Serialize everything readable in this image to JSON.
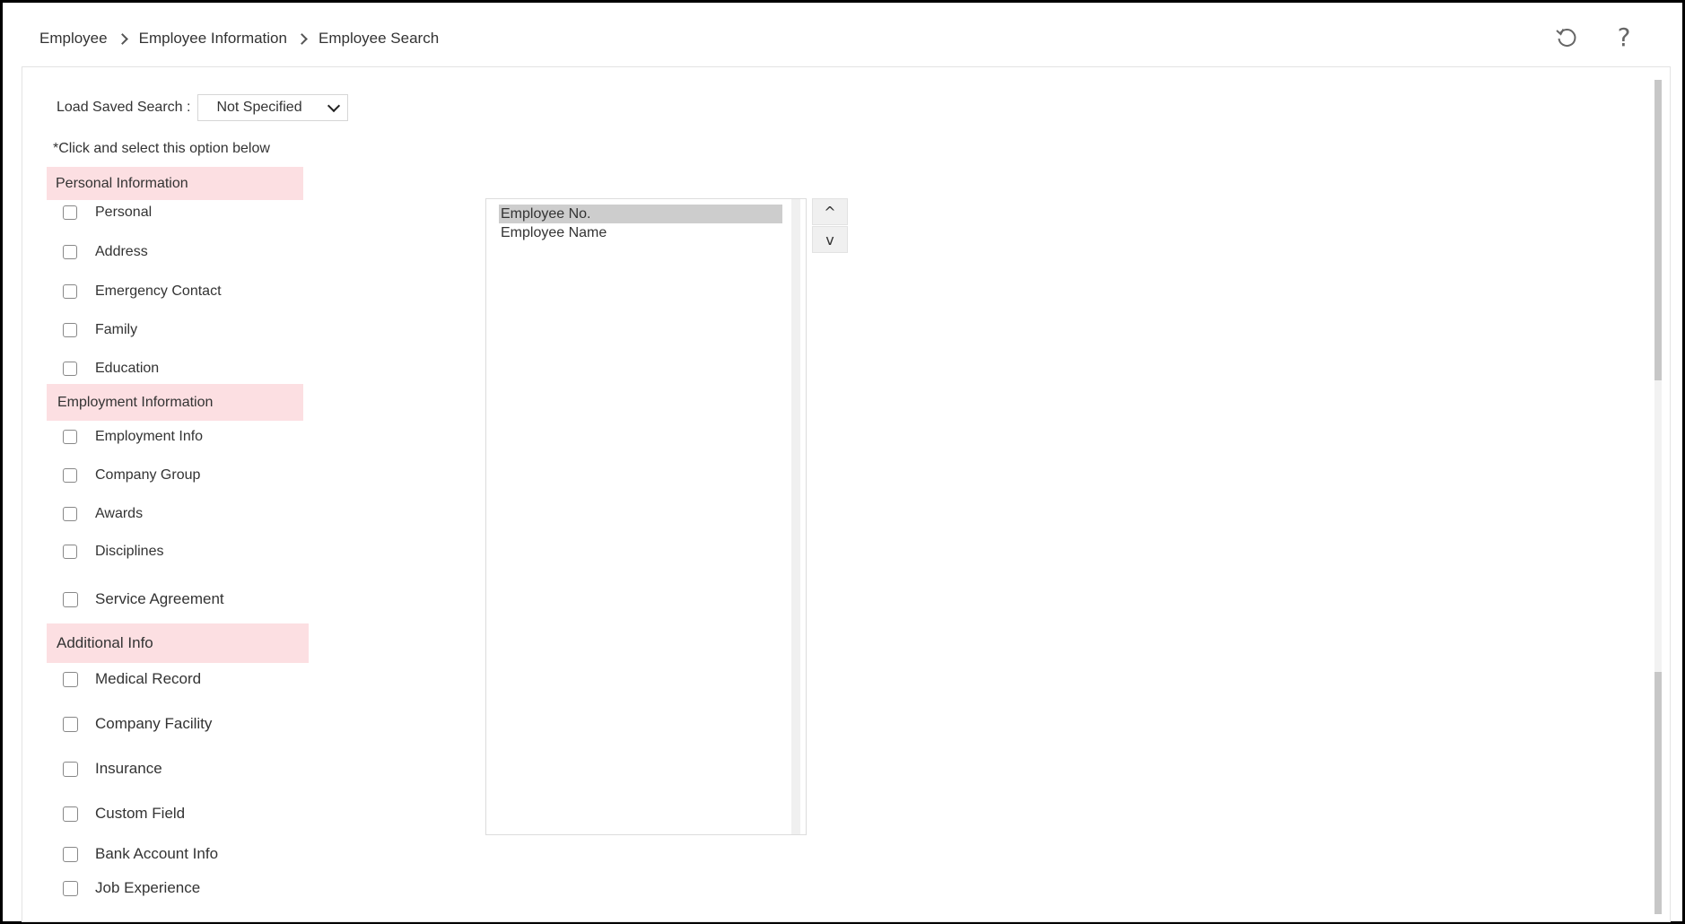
{
  "breadcrumb": [
    "Employee",
    "Employee Information",
    "Employee Search"
  ],
  "toolbar": {
    "refresh_icon": "refresh-icon",
    "help_icon": "help-icon",
    "help_glyph": "?"
  },
  "load_saved_search": {
    "label": "Load Saved Search :",
    "selected": "Not Specified"
  },
  "hint": "*Click and select this option below",
  "sections": {
    "personal": {
      "title": "Personal Information",
      "items": [
        "Personal",
        "Address",
        "Emergency Contact",
        "Family",
        "Education"
      ]
    },
    "employment": {
      "title": "Employment Information",
      "items": [
        "Employment Info",
        "Company Group",
        "Awards",
        "Disciplines",
        "Service Agreement"
      ]
    },
    "additional": {
      "title": "Additional Info",
      "items": [
        "Medical Record",
        "Company Facility",
        "Insurance",
        "Custom Field",
        "Bank Account Info",
        "Job Experience"
      ]
    }
  },
  "selected_columns": {
    "options": [
      "Employee No.",
      "Employee Name"
    ],
    "selected_index": 0
  },
  "order_buttons": {
    "up": "^",
    "down": "v"
  },
  "colors": {
    "section_header_bg": "#fcdfe2",
    "selected_option_bg": "#cdcdcd"
  }
}
